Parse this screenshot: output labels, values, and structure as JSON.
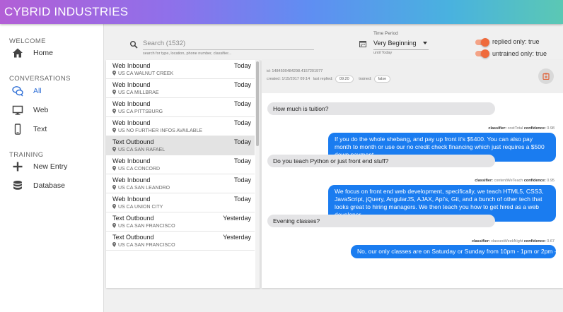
{
  "app": {
    "title": "CYBRID INDUSTRIES"
  },
  "sidebar": {
    "sections": [
      {
        "label": "WELCOME"
      },
      {
        "label": "CONVERSATIONS"
      },
      {
        "label": "TRAINING"
      }
    ],
    "items": [
      {
        "label": "Home",
        "icon": "home-icon"
      },
      {
        "label": "All",
        "icon": "chat-bubbles-icon",
        "active": true
      },
      {
        "label": "Web",
        "icon": "monitor-icon"
      },
      {
        "label": "Text",
        "icon": "phone-icon"
      },
      {
        "label": "New Entry",
        "icon": "plus-icon"
      },
      {
        "label": "Database",
        "icon": "database-icon"
      }
    ]
  },
  "search": {
    "placeholder": "Search (1532)",
    "hint": "search for type, location, phone number, classifier..."
  },
  "time_period": {
    "label": "Time Period",
    "value": "Very Beginning",
    "until": "until Today"
  },
  "filters": {
    "replied_only": "replied only: true",
    "untrained_only": "untrained only: true"
  },
  "conversations": [
    {
      "type": "Web Inbound",
      "date": "Today",
      "location": "US CA WALNUT CREEK"
    },
    {
      "type": "Web Inbound",
      "date": "Today",
      "location": "US CA MILLBRAE"
    },
    {
      "type": "Web Inbound",
      "date": "Today",
      "location": "US CA PITTSBURG"
    },
    {
      "type": "Web Inbound",
      "date": "Today",
      "location": "US NO FURTHER INFOS AVAILABLE"
    },
    {
      "type": "Text Outbound",
      "date": "Today",
      "location": "US CA SAN RAFAEL",
      "selected": true
    },
    {
      "type": "Web Inbound",
      "date": "Today",
      "location": "US CA CONCORD"
    },
    {
      "type": "Web Inbound",
      "date": "Today",
      "location": "US CA SAN LEANDRO"
    },
    {
      "type": "Web Inbound",
      "date": "Today",
      "location": "US CA UNION CITY"
    },
    {
      "type": "Text Outbound",
      "date": "Yesterday",
      "location": "US CA SAN FRANCISCO"
    },
    {
      "type": "Text Outbound",
      "date": "Yesterday",
      "location": "US CA SAN FRANCISCO"
    }
  ],
  "chat": {
    "id": "id: 1484500484298.4157201977",
    "created": "created: 1/15/2017 09:14",
    "last_replied_label": "last replied:",
    "last_replied": "09:20",
    "trained_label": "trained:",
    "trained": "false",
    "messages": [
      {
        "dir": "in",
        "text": "How much is tuition?"
      },
      {
        "dir": "out",
        "classifier_label": "classifier:",
        "classifier": "costTotal",
        "confidence_label": "confidence:",
        "confidence": "0.98",
        "text": "If you do the whole shebang, and pay up front it's $5400. You can also pay month to month or use our no credit check financing which just requires a $500 down payment."
      },
      {
        "dir": "in",
        "text": "Do you teach Python or just front end stuff?"
      },
      {
        "dir": "out",
        "classifier_label": "classifier:",
        "classifier": "contentWeTeach",
        "confidence_label": "confidence:",
        "confidence": "0.95",
        "text": "We focus on front end web development, specifically, we teach HTML5, CSS3, JavaScript, jQuery, AngularJS, AJAX, Api's, Git, and a bunch of other tech that looks great to hiring managers. We then teach you how to get hired as a web developer."
      },
      {
        "dir": "in",
        "text": "Evening classes?"
      },
      {
        "dir": "out",
        "classifier_label": "classifier:",
        "classifier": "classesWeekNight",
        "confidence_label": "confidence:",
        "confidence": "0.67",
        "text": "No, our only classes are on Saturday or Sunday from 10pm - 1pm or 2pm - 5pm."
      }
    ]
  },
  "colors": {
    "accent": "#1a7cf0",
    "toggle": "#ef6a3c",
    "active_nav": "#2f6fd6"
  }
}
